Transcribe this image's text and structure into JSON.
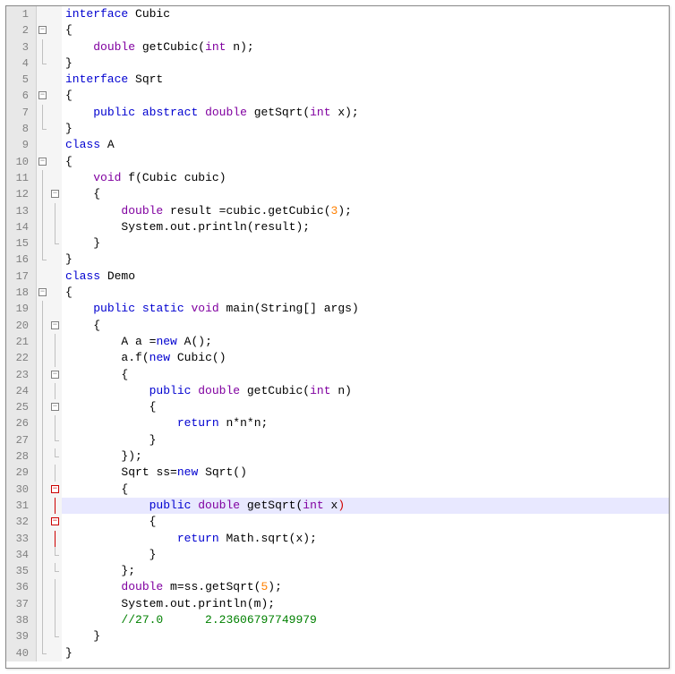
{
  "lines": [
    {
      "n": 1,
      "f1": "",
      "f2": "",
      "ind": 0,
      "tokens": [
        [
          "kw",
          "interface"
        ],
        [
          "pn",
          " "
        ],
        [
          "id",
          "Cubic"
        ]
      ]
    },
    {
      "n": 2,
      "f1": "box",
      "f2": "",
      "ind": 0,
      "tokens": [
        [
          "pn",
          "{"
        ]
      ]
    },
    {
      "n": 3,
      "f1": "line",
      "f2": "",
      "ind": 1,
      "tokens": [
        [
          "dt",
          "double"
        ],
        [
          "pn",
          " "
        ],
        [
          "fn",
          "getCubic"
        ],
        [
          "pn",
          "("
        ],
        [
          "dt",
          "int"
        ],
        [
          "pn",
          " n);"
        ]
      ]
    },
    {
      "n": 4,
      "f1": "end",
      "f2": "",
      "ind": 0,
      "tokens": [
        [
          "pn",
          "}"
        ]
      ]
    },
    {
      "n": 5,
      "f1": "",
      "f2": "",
      "ind": 0,
      "tokens": [
        [
          "kw",
          "interface"
        ],
        [
          "pn",
          " "
        ],
        [
          "id",
          "Sqrt"
        ]
      ]
    },
    {
      "n": 6,
      "f1": "box",
      "f2": "",
      "ind": 0,
      "tokens": [
        [
          "pn",
          "{"
        ]
      ]
    },
    {
      "n": 7,
      "f1": "line",
      "f2": "",
      "ind": 1,
      "tokens": [
        [
          "kw",
          "public"
        ],
        [
          "pn",
          " "
        ],
        [
          "kw",
          "abstract"
        ],
        [
          "pn",
          " "
        ],
        [
          "dt",
          "double"
        ],
        [
          "pn",
          " "
        ],
        [
          "fn",
          "getSqrt"
        ],
        [
          "pn",
          "("
        ],
        [
          "dt",
          "int"
        ],
        [
          "pn",
          " x);"
        ]
      ]
    },
    {
      "n": 8,
      "f1": "end",
      "f2": "",
      "ind": 0,
      "tokens": [
        [
          "pn",
          "}"
        ]
      ]
    },
    {
      "n": 9,
      "f1": "",
      "f2": "",
      "ind": 0,
      "tokens": [
        [
          "kw",
          "class"
        ],
        [
          "pn",
          " "
        ],
        [
          "id",
          "A"
        ]
      ]
    },
    {
      "n": 10,
      "f1": "box",
      "f2": "",
      "ind": 0,
      "tokens": [
        [
          "pn",
          "{"
        ]
      ]
    },
    {
      "n": 11,
      "f1": "line",
      "f2": "",
      "ind": 1,
      "tokens": [
        [
          "dt",
          "void"
        ],
        [
          "pn",
          " "
        ],
        [
          "fn",
          "f"
        ],
        [
          "pn",
          "("
        ],
        [
          "id",
          "Cubic"
        ],
        [
          "pn",
          " cubic)"
        ]
      ]
    },
    {
      "n": 12,
      "f1": "line",
      "f2": "box",
      "ind": 1,
      "tokens": [
        [
          "pn",
          "{"
        ]
      ]
    },
    {
      "n": 13,
      "f1": "line",
      "f2": "line",
      "ind": 2,
      "tokens": [
        [
          "dt",
          "double"
        ],
        [
          "pn",
          " result "
        ],
        [
          "op",
          "="
        ],
        [
          "pn",
          "cubic."
        ],
        [
          "fn",
          "getCubic"
        ],
        [
          "pn",
          "("
        ],
        [
          "num",
          "3"
        ],
        [
          "pn",
          ");"
        ]
      ]
    },
    {
      "n": 14,
      "f1": "line",
      "f2": "line",
      "ind": 2,
      "tokens": [
        [
          "id",
          "System"
        ],
        [
          "pn",
          ".out."
        ],
        [
          "fn",
          "println"
        ],
        [
          "pn",
          "(result);"
        ]
      ]
    },
    {
      "n": 15,
      "f1": "line",
      "f2": "end",
      "ind": 1,
      "tokens": [
        [
          "pn",
          "}"
        ]
      ]
    },
    {
      "n": 16,
      "f1": "end",
      "f2": "",
      "ind": 0,
      "tokens": [
        [
          "pn",
          "}"
        ]
      ]
    },
    {
      "n": 17,
      "f1": "",
      "f2": "",
      "ind": 0,
      "tokens": [
        [
          "kw",
          "class"
        ],
        [
          "pn",
          " "
        ],
        [
          "id",
          "Demo"
        ]
      ]
    },
    {
      "n": 18,
      "f1": "box",
      "f2": "",
      "ind": 0,
      "tokens": [
        [
          "pn",
          "{"
        ]
      ]
    },
    {
      "n": 19,
      "f1": "line",
      "f2": "",
      "ind": 1,
      "tokens": [
        [
          "kw",
          "public"
        ],
        [
          "pn",
          " "
        ],
        [
          "kw",
          "static"
        ],
        [
          "pn",
          " "
        ],
        [
          "dt",
          "void"
        ],
        [
          "pn",
          " "
        ],
        [
          "fn",
          "main"
        ],
        [
          "pn",
          "("
        ],
        [
          "id",
          "String"
        ],
        [
          "pn",
          "[] args)"
        ]
      ]
    },
    {
      "n": 20,
      "f1": "line",
      "f2": "box",
      "ind": 1,
      "tokens": [
        [
          "pn",
          "{"
        ]
      ]
    },
    {
      "n": 21,
      "f1": "line",
      "f2": "line",
      "ind": 2,
      "tokens": [
        [
          "id",
          "A"
        ],
        [
          "pn",
          " a "
        ],
        [
          "op",
          "="
        ],
        [
          "kw",
          "new"
        ],
        [
          "pn",
          " "
        ],
        [
          "fn",
          "A"
        ],
        [
          "pn",
          "();"
        ]
      ]
    },
    {
      "n": 22,
      "f1": "line",
      "f2": "line",
      "ind": 2,
      "tokens": [
        [
          "pn",
          "a."
        ],
        [
          "fn",
          "f"
        ],
        [
          "pn",
          "("
        ],
        [
          "kw",
          "new"
        ],
        [
          "pn",
          " "
        ],
        [
          "fn",
          "Cubic"
        ],
        [
          "pn",
          "()"
        ]
      ]
    },
    {
      "n": 23,
      "f1": "line",
      "f2": "box",
      "ind": 2,
      "tokens": [
        [
          "pn",
          "{"
        ]
      ]
    },
    {
      "n": 24,
      "f1": "line",
      "f2": "line",
      "ind": 3,
      "tokens": [
        [
          "kw",
          "public"
        ],
        [
          "pn",
          " "
        ],
        [
          "dt",
          "double"
        ],
        [
          "pn",
          " "
        ],
        [
          "fn",
          "getCubic"
        ],
        [
          "pn",
          "("
        ],
        [
          "dt",
          "int"
        ],
        [
          "pn",
          " n)"
        ]
      ]
    },
    {
      "n": 25,
      "f1": "line",
      "f2": "box",
      "ind": 3,
      "tokens": [
        [
          "pn",
          "{"
        ]
      ]
    },
    {
      "n": 26,
      "f1": "line",
      "f2": "line",
      "ind": 4,
      "tokens": [
        [
          "kw",
          "return"
        ],
        [
          "pn",
          " n"
        ],
        [
          "op",
          "*"
        ],
        [
          "pn",
          "n"
        ],
        [
          "op",
          "*"
        ],
        [
          "pn",
          "n;"
        ]
      ]
    },
    {
      "n": 27,
      "f1": "line",
      "f2": "end",
      "ind": 3,
      "tokens": [
        [
          "pn",
          "}"
        ]
      ]
    },
    {
      "n": 28,
      "f1": "line",
      "f2": "end",
      "ind": 2,
      "tokens": [
        [
          "pn",
          "});"
        ]
      ]
    },
    {
      "n": 29,
      "f1": "line",
      "f2": "line",
      "ind": 2,
      "tokens": [
        [
          "id",
          "Sqrt"
        ],
        [
          "pn",
          " ss"
        ],
        [
          "op",
          "="
        ],
        [
          "kw",
          "new"
        ],
        [
          "pn",
          " "
        ],
        [
          "fn",
          "Sqrt"
        ],
        [
          "pn",
          "()"
        ]
      ]
    },
    {
      "n": 30,
      "f1": "line",
      "f2": "boxred",
      "ind": 2,
      "tokens": [
        [
          "pn",
          "{"
        ]
      ]
    },
    {
      "n": 31,
      "f1": "line",
      "f2": "linered",
      "ind": 3,
      "hl": true,
      "tokens": [
        [
          "kw",
          "public"
        ],
        [
          "pn",
          " "
        ],
        [
          "dt",
          "double"
        ],
        [
          "pn",
          " "
        ],
        [
          "fn",
          "getSqrt"
        ],
        [
          "pn",
          "("
        ],
        [
          "dt",
          "int"
        ],
        [
          "pn",
          " x"
        ],
        [
          "paren-match",
          ")"
        ]
      ]
    },
    {
      "n": 32,
      "f1": "line",
      "f2": "boxred",
      "ind": 3,
      "tokens": [
        [
          "pn",
          "{"
        ]
      ]
    },
    {
      "n": 33,
      "f1": "line",
      "f2": "linered",
      "ind": 4,
      "tokens": [
        [
          "kw",
          "return"
        ],
        [
          "pn",
          " Math."
        ],
        [
          "fn",
          "sqrt"
        ],
        [
          "pn",
          "(x);"
        ]
      ]
    },
    {
      "n": 34,
      "f1": "line",
      "f2": "end",
      "ind": 3,
      "tokens": [
        [
          "pn",
          "}"
        ]
      ]
    },
    {
      "n": 35,
      "f1": "line",
      "f2": "end",
      "ind": 2,
      "tokens": [
        [
          "pn",
          "};"
        ]
      ]
    },
    {
      "n": 36,
      "f1": "line",
      "f2": "line",
      "ind": 2,
      "tokens": [
        [
          "dt",
          "double"
        ],
        [
          "pn",
          " m"
        ],
        [
          "op",
          "="
        ],
        [
          "pn",
          "ss."
        ],
        [
          "fn",
          "getSqrt"
        ],
        [
          "pn",
          "("
        ],
        [
          "num",
          "5"
        ],
        [
          "pn",
          ");"
        ]
      ]
    },
    {
      "n": 37,
      "f1": "line",
      "f2": "line",
      "ind": 2,
      "tokens": [
        [
          "id",
          "System"
        ],
        [
          "pn",
          ".out."
        ],
        [
          "fn",
          "println"
        ],
        [
          "pn",
          "(m);"
        ]
      ]
    },
    {
      "n": 38,
      "f1": "line",
      "f2": "line",
      "ind": 2,
      "tokens": [
        [
          "cm",
          "//27.0      2.23606797749979"
        ]
      ]
    },
    {
      "n": 39,
      "f1": "line",
      "f2": "end",
      "ind": 1,
      "tokens": [
        [
          "pn",
          "}"
        ]
      ]
    },
    {
      "n": 40,
      "f1": "end",
      "f2": "",
      "ind": 0,
      "tokens": [
        [
          "pn",
          "}"
        ]
      ]
    }
  ],
  "indent_unit": "    "
}
